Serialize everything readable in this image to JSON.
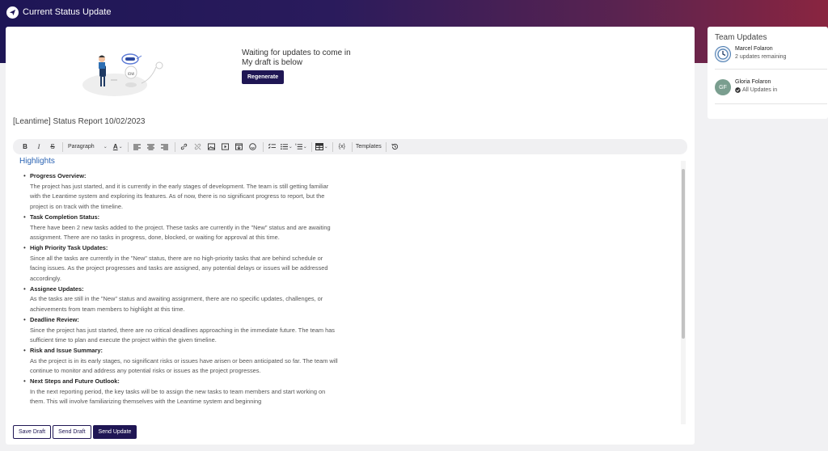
{
  "window": {
    "title": "Current Status Update",
    "icon": "paper-plane-icon"
  },
  "header": {
    "waiting_line1": "Waiting for updates to come in",
    "waiting_line2": "My draft is below",
    "regenerate_label": "Regenerate"
  },
  "report": {
    "title": "[Leantime] Status Report 10/02/2023"
  },
  "toolbar": {
    "bold": "B",
    "italic": "I",
    "strike": "S",
    "format_select": "Paragraph",
    "text_color": "A",
    "variables": "{x}",
    "templates": "Templates"
  },
  "editor": {
    "section_title": "Highlights",
    "items": [
      {
        "head": "Progress Overview:",
        "body": "The project has just started, and it is currently in the early stages of development. The team is still getting familiar with the Leantime system and exploring its features. As of now, there is no significant progress to report, but the project is on track with the timeline."
      },
      {
        "head": "Task Completion Status:",
        "body": "There have been 2 new tasks added to the project. These tasks are currently in the \"New\" status and are awaiting assignment. There are no tasks in progress, done, blocked, or waiting for approval at this time."
      },
      {
        "head": "High Priority Task Updates:",
        "body": "Since all the tasks are currently in the \"New\" status, there are no high-priority tasks that are behind schedule or facing issues. As the project progresses and tasks are assigned, any potential delays or issues will be addressed accordingly."
      },
      {
        "head": "Assignee Updates:",
        "body": "As the tasks are still in the \"New\" status and awaiting assignment, there are no specific updates, challenges, or achievements from team members to highlight at this time."
      },
      {
        "head": "Deadline Review:",
        "body": "Since the project has just started, there are no critical deadlines approaching in the immediate future. The team has sufficient time to plan and execute the project within the given timeline."
      },
      {
        "head": "Risk and Issue Summary:",
        "body": "As the project is in its early stages, no significant risks or issues have arisen or been anticipated so far. The team will continue to monitor and address any potential risks or issues as the project progresses."
      },
      {
        "head": "Next Steps and Future Outlook:",
        "body": "In the next reporting period, the key tasks will be to assign the new tasks to team members and start working on them. This will involve familiarizing themselves with the Leantime system and beginning"
      }
    ]
  },
  "footer": {
    "save_draft": "Save Draft",
    "send_draft": "Send Draft",
    "send_update": "Send Update"
  },
  "team_updates": {
    "title": "Team Updates",
    "members": [
      {
        "name": "Marcel Folaron",
        "status": "2 updates remaining",
        "avatar_icon": "clock-icon"
      },
      {
        "name": "Gloria Folaron",
        "status": "All Updates in",
        "initials": "GF",
        "status_icon": "check-circle-icon"
      }
    ]
  },
  "colors": {
    "primary": "#1f1654",
    "accent_link": "#2a63b3",
    "avatar_gf": "#7a9e8f",
    "avatar_clock": "#4a7bb0"
  }
}
